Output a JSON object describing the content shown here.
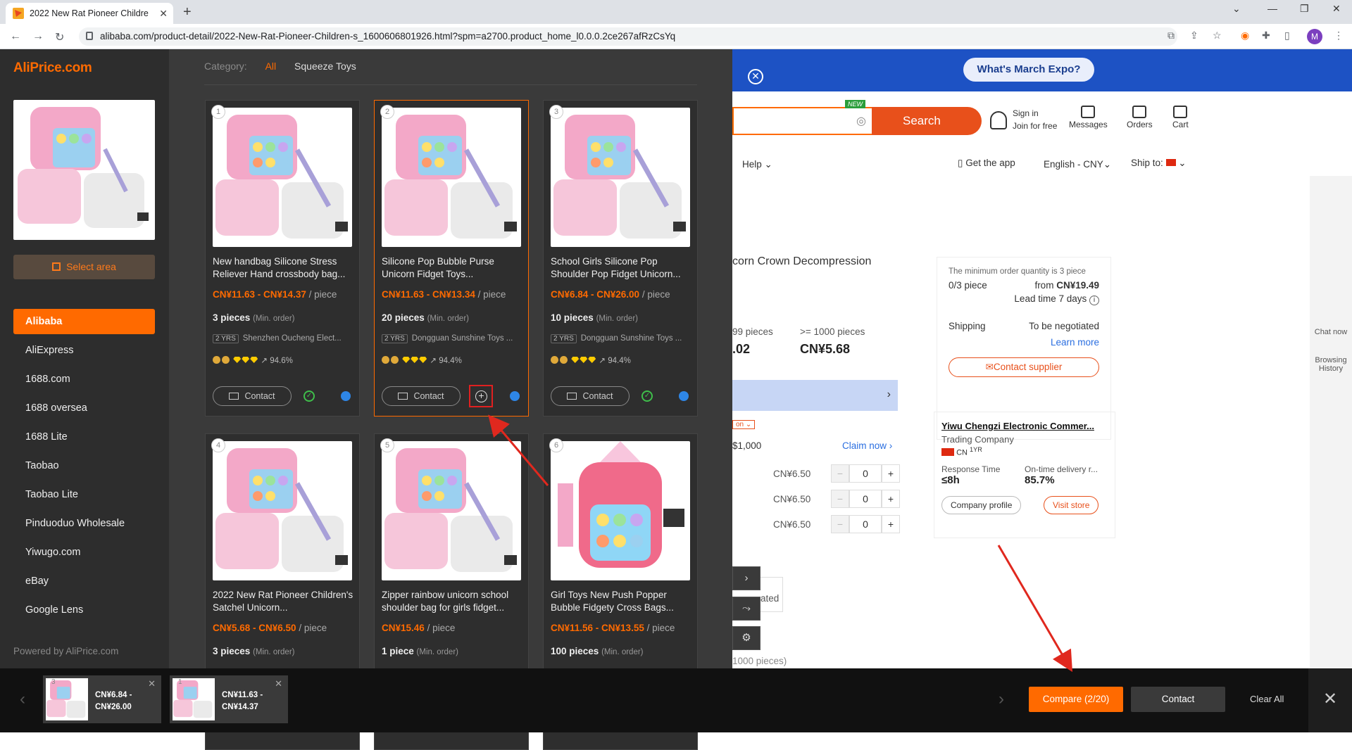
{
  "browser": {
    "tab_title": "2022 New Rat Pioneer Childre",
    "url": "alibaba.com/product-detail/2022-New-Rat-Pioneer-Children-s_1600606801926.html?spm=a2700.product_home_l0.0.0.2ce267afRzCsYq",
    "avatar_letter": "M"
  },
  "site": {
    "expo_label": "What's March Expo?",
    "new_badge": "NEW",
    "search_label": "Search",
    "signin": "Sign in",
    "join": "Join for free",
    "messages": "Messages",
    "orders": "Orders",
    "cart": "Cart",
    "help": "Help",
    "get_app": "Get the app",
    "language": "English - CNY",
    "ship_to": "Ship to:",
    "product_title": "corn Crown Decompression",
    "tier1_label": "99 pieces",
    "tier1_price": ".02",
    "tier2_label": ">= 1000 pieces",
    "tier2_price": "CN¥5.68",
    "coupon_tag": "on",
    "coupon_amount": "$1,000",
    "claim_now": "Claim now",
    "variant_price": "CN¥6.50",
    "qty": "0",
    "ated": "ated",
    "pieces_note": "1000 pieces)",
    "order_min_note": "The minimum order quantity is 3 piece",
    "order_count": "0/3 piece",
    "order_from": "from",
    "order_price": "CN¥19.49",
    "lead_time": "Lead time 7 days",
    "shipping_label": "Shipping",
    "shipping_value": "To be negotiated",
    "learn_more": "Learn more",
    "contact_supplier": "Contact supplier",
    "supplier_name": "Yiwu Chengzi Electronic Commer...",
    "supplier_type": "Trading Company",
    "supplier_country": "CN",
    "supplier_years": "1YR",
    "response_label": "Response Time",
    "response_value": "≤8h",
    "delivery_label": "On-time delivery r...",
    "delivery_value": "85.7%",
    "company_profile": "Company profile",
    "visit_store": "Visit store",
    "chat_now": "Chat now",
    "browsing_history": "Browsing History"
  },
  "aliprice": {
    "brand": "AliPrice.com",
    "select_area": "Select area",
    "sources": [
      "Alibaba",
      "AliExpress",
      "1688.com",
      "1688 oversea",
      "1688 Lite",
      "Taobao",
      "Taobao Lite",
      "Pinduoduo Wholesale",
      "Yiwugo.com",
      "eBay",
      "Google Lens"
    ],
    "active_source": "Alibaba",
    "powered_by": "Powered by AliPrice.com",
    "category_label": "Category:",
    "category_all": "All",
    "category_sq": "Squeeze Toys"
  },
  "products": [
    {
      "num": "1",
      "name": "New handbag Silicone Stress Reliever Hand crossbody bag...",
      "price": "CN¥11.63 - CN¥14.37",
      "unit": "/ piece",
      "moq": "3 pieces",
      "moq_note": "(Min. order)",
      "years": "2",
      "yrs_label": "YRS",
      "supplier": "Shenzhen Oucheng Elect...",
      "rate": "94.6%",
      "contact": "Contact"
    },
    {
      "num": "2",
      "name": "Silicone Pop Bubble Purse Unicorn Fidget Toys...",
      "price": "CN¥11.63 - CN¥13.34",
      "unit": "/ piece",
      "moq": "20 pieces",
      "moq_note": "(Min. order)",
      "years": "2",
      "yrs_label": "YRS",
      "supplier": "Dongguan Sunshine Toys ...",
      "rate": "94.4%",
      "contact": "Contact"
    },
    {
      "num": "3",
      "name": "School Girls Silicone Pop Shoulder Pop Fidget Unicorn...",
      "price": "CN¥6.84 - CN¥26.00",
      "unit": "/ piece",
      "moq": "10 pieces",
      "moq_note": "(Min. order)",
      "years": "2",
      "yrs_label": "YRS",
      "supplier": "Dongguan Sunshine Toys ...",
      "rate": "94.4%",
      "contact": "Contact"
    },
    {
      "num": "4",
      "name": "2022 New Rat Pioneer Children's Satchel Unicorn...",
      "price": "CN¥5.68 - CN¥6.50",
      "unit": "/ piece",
      "moq": "3 pieces",
      "moq_note": "(Min. order)"
    },
    {
      "num": "5",
      "name": "Zipper rainbow unicorn school shoulder bag for girls fidget...",
      "price": "CN¥15.46",
      "unit": "/ piece",
      "moq": "1 piece",
      "moq_note": "(Min. order)"
    },
    {
      "num": "6",
      "name": "Girl Toys New Push Popper Bubble Fidgety Cross Bags...",
      "price": "CN¥11.56 - CN¥13.55",
      "unit": "/ piece",
      "moq": "100 pieces",
      "moq_note": "(Min. order)"
    }
  ],
  "compare_bar": {
    "items": [
      {
        "num": "3",
        "price_line1": "CN¥6.84 -",
        "price_line2": "CN¥26.00"
      },
      {
        "num": "1",
        "price_line1": "CN¥11.63 -",
        "price_line2": "CN¥14.37"
      }
    ],
    "compare_label": "Compare (2/20)",
    "contact_label": "Contact",
    "clear_all": "Clear All"
  },
  "colors": {
    "accent": "#ff6a00",
    "annotation": "#e0281e"
  }
}
